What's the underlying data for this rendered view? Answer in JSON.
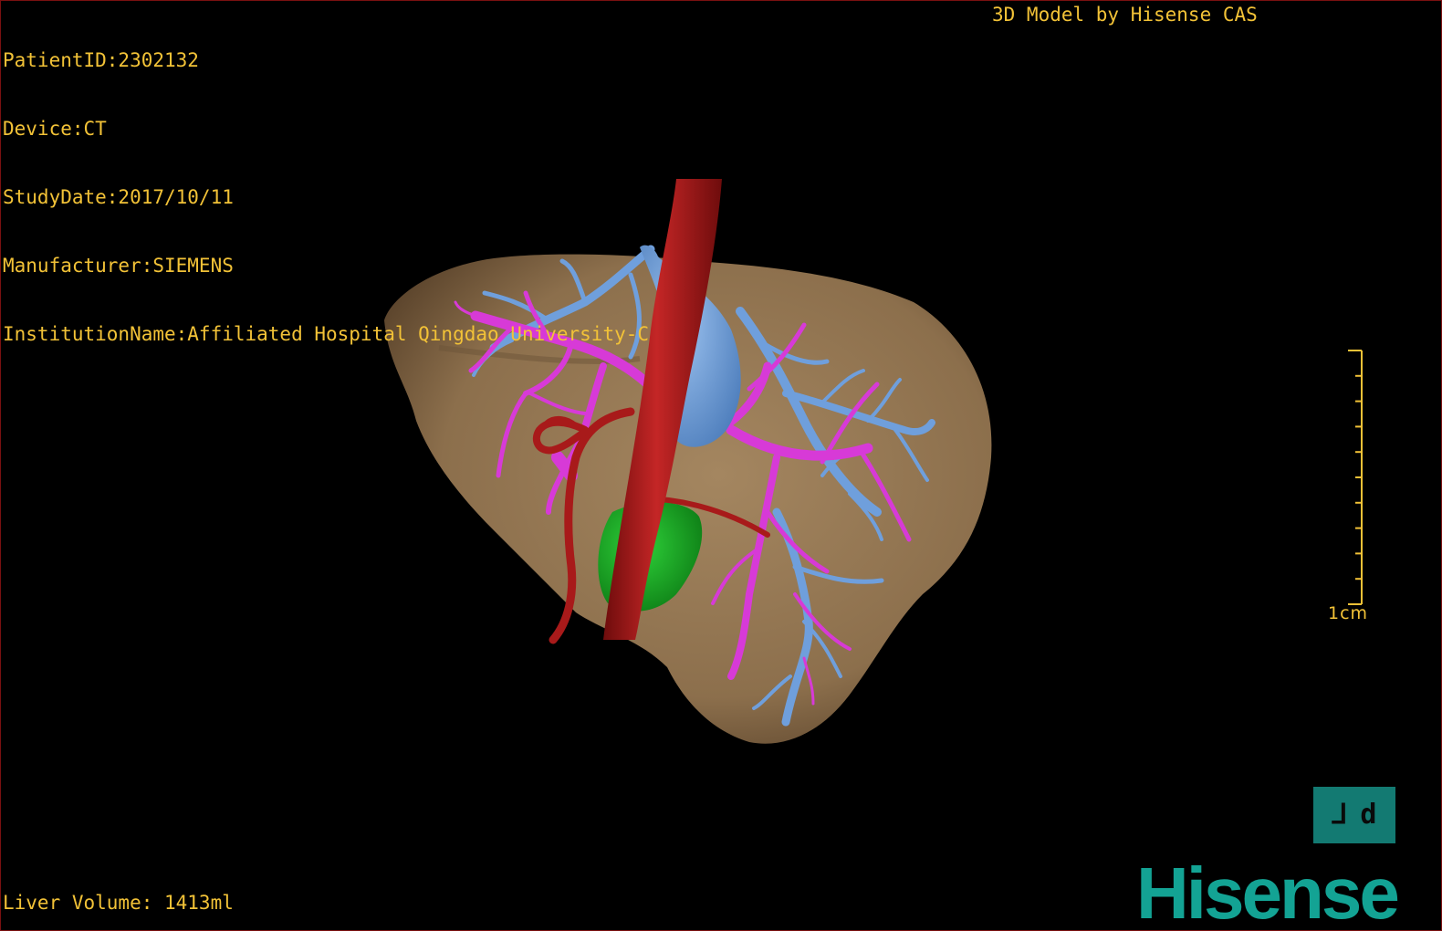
{
  "header": {
    "patient_id": "PatientID:2302132",
    "device": "Device:CT",
    "study_date": "StudyDate:2017/10/11",
    "manufacturer": "Manufacturer:SIEMENS",
    "institution": "InstitutionName:Affiliated Hospital Qingdao University-C"
  },
  "brand_text": "3D Model by Hisense CAS",
  "volume_text": "Liver Volume: 1413ml",
  "scale": {
    "label": "1cm",
    "ticks": 10
  },
  "orientation_marker": {
    "left": "⅃",
    "right": "d"
  },
  "logo_text": "Hisense",
  "colors": {
    "overlay_text": "#f2c237",
    "liver": "#8c6f4c",
    "hepatic_artery_aorta": "#a81a1a",
    "portal_vein": "#d73ad7",
    "hepatic_vein": "#6f9fdc",
    "gallbladder": "#16a31f",
    "logo": "#13a394",
    "frame": "#7a1010"
  },
  "icons": [
    "liver-model-icon",
    "orientation-marker-icon",
    "scale-bar-icon",
    "hisense-logo"
  ]
}
